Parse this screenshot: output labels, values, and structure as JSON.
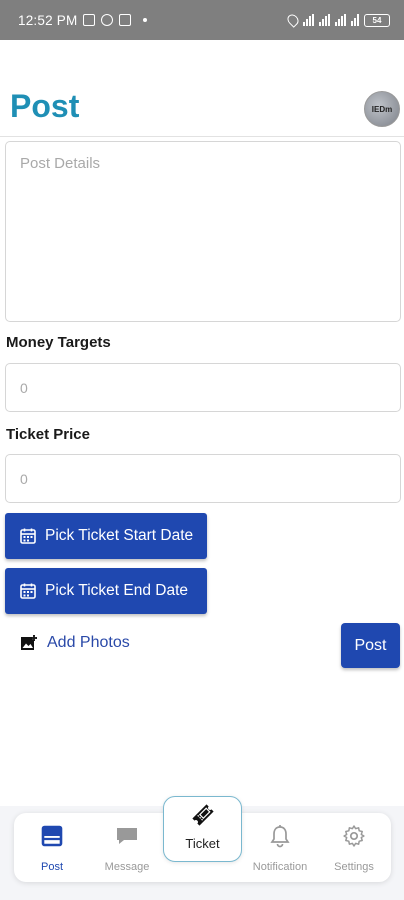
{
  "status_bar": {
    "time": "12:52 PM",
    "battery": "54"
  },
  "header": {
    "title": "Post",
    "avatar_text": "IEDm"
  },
  "form": {
    "details_placeholder": "Post Details",
    "money_targets_label": "Money Targets",
    "money_targets_placeholder": "0",
    "ticket_price_label": "Ticket Price",
    "ticket_price_placeholder": "0",
    "pick_start_label": "Pick Ticket Start Date",
    "pick_end_label": "Pick Ticket End Date",
    "add_photos_label": "Add Photos",
    "post_button_label": "Post"
  },
  "nav": {
    "items": [
      {
        "label": "Post",
        "icon": "post-icon",
        "active": true
      },
      {
        "label": "Message",
        "icon": "message-icon",
        "active": false
      },
      {
        "label": "Ticket",
        "icon": "ticket-icon",
        "active": false
      },
      {
        "label": "Notification",
        "icon": "bell-icon",
        "active": false
      },
      {
        "label": "Settings",
        "icon": "gear-icon",
        "active": false
      }
    ]
  },
  "colors": {
    "accent": "#1f48b0",
    "title": "#1f8fb5",
    "status_bar": "#7f7f7f"
  }
}
